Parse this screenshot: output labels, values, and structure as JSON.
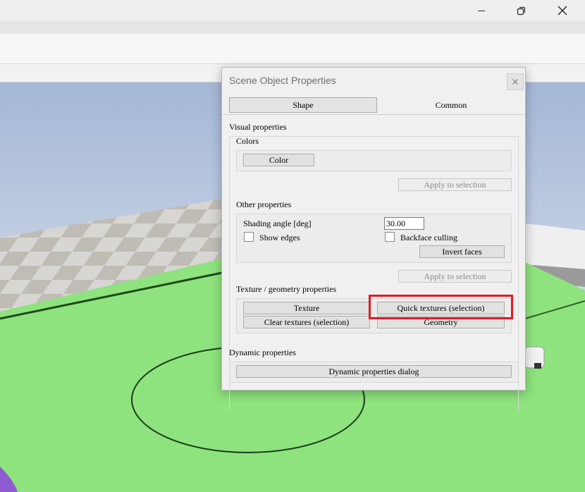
{
  "window": {
    "minimize_icon": "minimize-icon",
    "maximize_icon": "restore-icon",
    "close_icon": "close-icon"
  },
  "dialog": {
    "title": "Scene Object Properties",
    "close_icon": "close-icon",
    "tabs": [
      {
        "label": "Shape",
        "active": true
      },
      {
        "label": "Common",
        "active": false
      }
    ],
    "visual_properties": {
      "heading": "Visual properties",
      "colors": {
        "heading": "Colors",
        "color_button": "Color",
        "apply_button": "Apply to selection"
      },
      "other": {
        "heading": "Other properties",
        "shading_angle_label": "Shading angle [deg]",
        "shading_angle_value": "30.00",
        "show_edges_label": "Show edges",
        "show_edges_checked": false,
        "backface_culling_label": "Backface culling",
        "backface_culling_checked": false,
        "invert_faces_button": "Invert faces",
        "apply_button": "Apply to selection"
      },
      "texture": {
        "heading": "Texture / geometry properties",
        "texture_button": "Texture",
        "quick_textures_button": "Quick textures (selection)",
        "clear_textures_button": "Clear textures (selection)",
        "geometry_button": "Geometry"
      }
    },
    "dynamic_properties": {
      "heading": "Dynamic properties",
      "dialog_button": "Dynamic properties dialog"
    }
  },
  "colors": {
    "highlight": "#e01b24",
    "floor": "#8ee37e",
    "sky_top": "#a4b7d6"
  }
}
